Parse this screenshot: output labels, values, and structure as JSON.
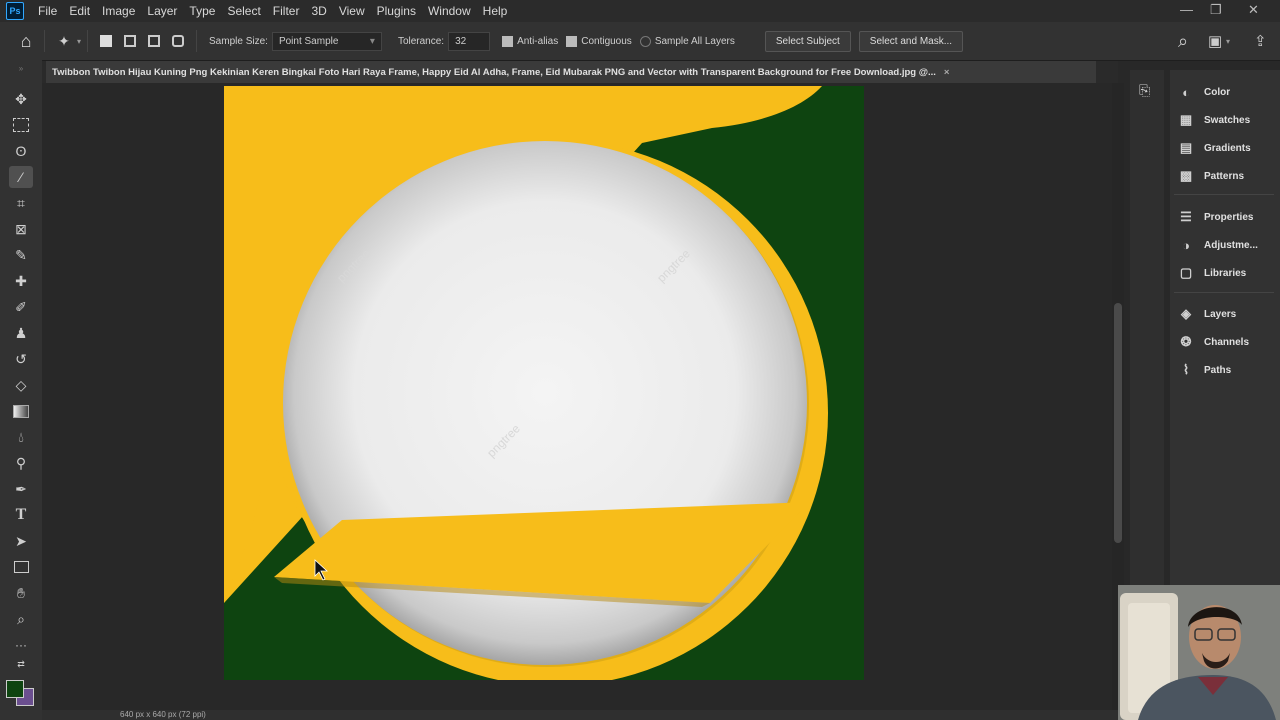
{
  "app": {
    "logo": "Ps"
  },
  "menu": [
    "File",
    "Edit",
    "Image",
    "Layer",
    "Type",
    "Select",
    "Filter",
    "3D",
    "View",
    "Plugins",
    "Window",
    "Help"
  ],
  "window_controls": {
    "minimize": "—",
    "restore": "❐",
    "close": "✕"
  },
  "options": {
    "sample_size_label": "Sample Size:",
    "sample_size_value": "Point Sample",
    "tolerance_label": "Tolerance:",
    "tolerance_value": "32",
    "antialias": "Anti-alias",
    "contiguous": "Contiguous",
    "sample_all_layers": "Sample All Layers",
    "select_subject": "Select Subject",
    "select_and_mask": "Select and Mask..."
  },
  "document": {
    "tab_title": "Twibbon Twibon Hijau Kuning Png Kekinian Keren Bingkai Foto Hari Raya Frame, Happy Eid Al Adha, Frame, Eid Mubarak PNG and Vector with Transparent Background for Free Download.jpg @...",
    "tab_close": "×",
    "watermark": "pngtree",
    "status": "640 px x 640 px (72 ppi)"
  },
  "panels": {
    "group1": [
      "Color",
      "Swatches",
      "Gradients",
      "Patterns"
    ],
    "group2": [
      "Properties",
      "Adjustme...",
      "Libraries"
    ],
    "group3": [
      "Layers",
      "Channels",
      "Paths"
    ]
  },
  "icons": {
    "home": "⌂",
    "search": "⌕",
    "share": "⇪",
    "panel_toggle": "▣"
  },
  "colors": {
    "frame_yellow": "#f7bd1a",
    "frame_green": "#0e4410",
    "foreground": "#0e4410",
    "background": "#6b4f8f"
  }
}
